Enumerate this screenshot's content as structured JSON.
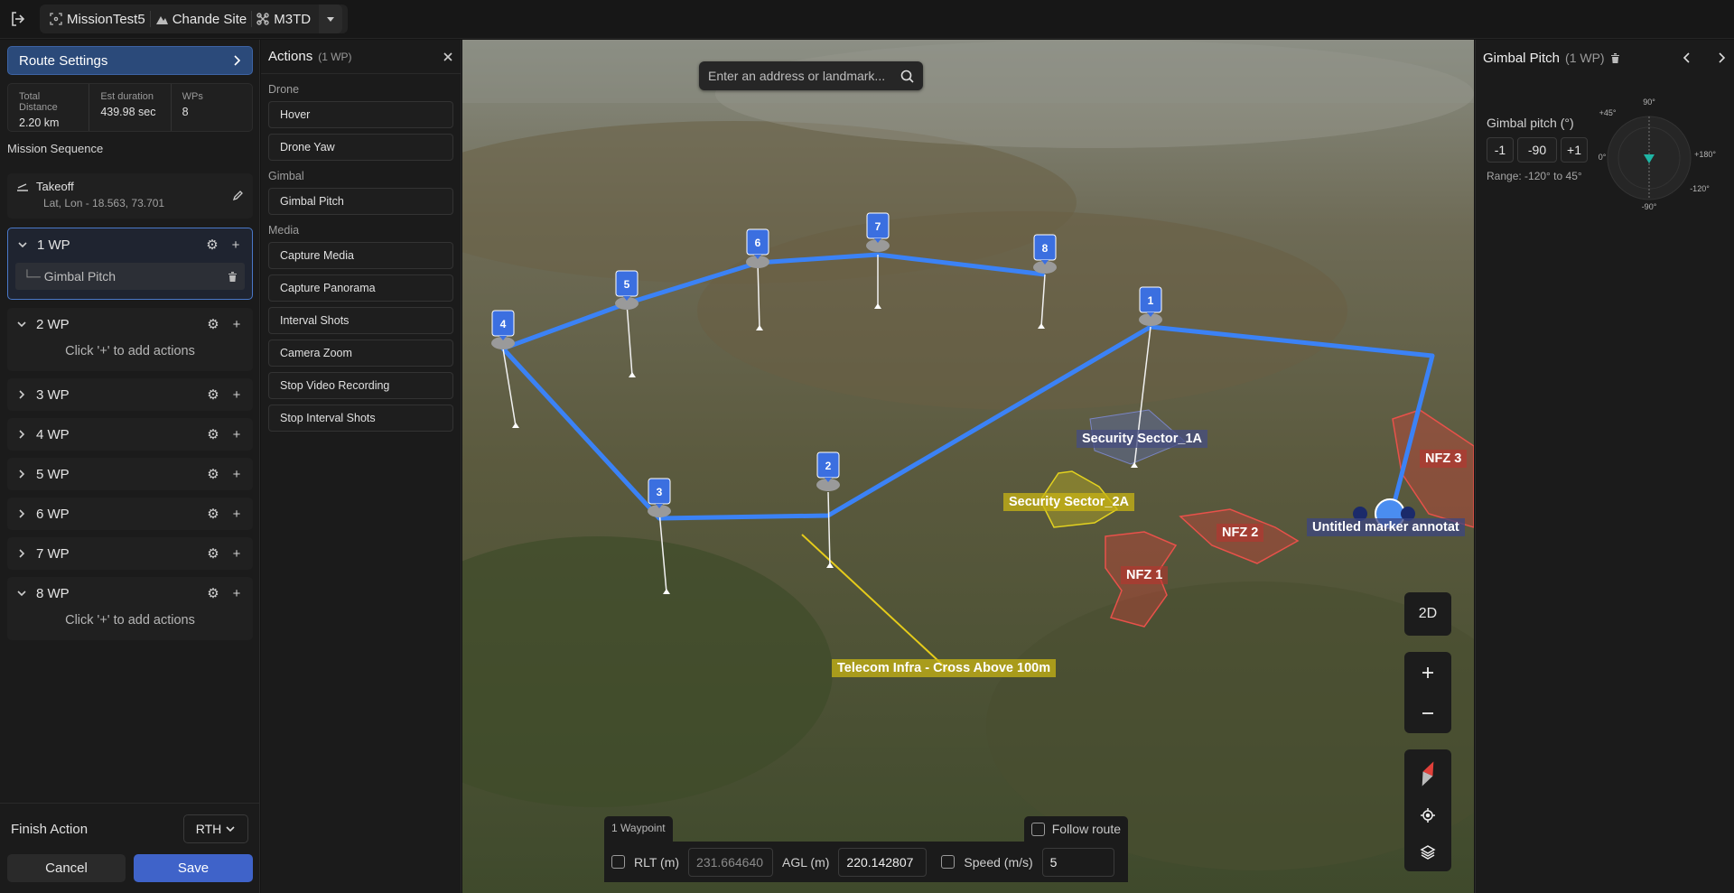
{
  "topbar": {
    "crumbs": [
      {
        "label": "MissionTest5",
        "icon": "mission-icon"
      },
      {
        "label": "Chande Site",
        "icon": "site-icon"
      },
      {
        "label": "M3TD",
        "icon": "drone-icon"
      }
    ]
  },
  "left": {
    "route_settings": "Route Settings",
    "stats": [
      {
        "label": "Total Distance",
        "value": "2.20 km"
      },
      {
        "label": "Est duration",
        "value": "439.98 sec"
      },
      {
        "label": "WPs",
        "value": "8"
      }
    ],
    "sequence_title": "Mission Sequence",
    "takeoff": {
      "title": "Takeoff",
      "coords": "Lat, Lon - 18.563, 73.701"
    },
    "waypoints": [
      {
        "name": "1 WP",
        "expanded": true,
        "action": "Gimbal Pitch"
      },
      {
        "name": "2 WP",
        "expanded": true,
        "hint": "Click '+' to add actions"
      },
      {
        "name": "3 WP"
      },
      {
        "name": "4 WP"
      },
      {
        "name": "5 WP"
      },
      {
        "name": "6 WP"
      },
      {
        "name": "7 WP"
      },
      {
        "name": "8 WP",
        "expanded": true,
        "hint": "Click '+' to add actions"
      }
    ],
    "finish_action_label": "Finish Action",
    "finish_action_value": "RTH",
    "cancel": "Cancel",
    "save": "Save"
  },
  "actions": {
    "title": "Actions",
    "count": "(1 WP)",
    "groups": [
      {
        "name": "Drone",
        "items": [
          "Hover",
          "Drone Yaw"
        ]
      },
      {
        "name": "Gimbal",
        "items": [
          "Gimbal Pitch"
        ]
      },
      {
        "name": "Media",
        "items": [
          "Capture Media",
          "Capture Panorama",
          "Interval Shots",
          "Camera Zoom",
          "Stop Video Recording",
          "Stop Interval Shots"
        ]
      }
    ]
  },
  "map": {
    "search_placeholder": "Enter an address or landmark...",
    "waypoint_markers": [
      "1",
      "2",
      "3",
      "4",
      "5",
      "6",
      "7",
      "8"
    ],
    "labels": {
      "sec1a": "Security Sector_1A",
      "sec2a": "Security Sector_2A",
      "nfz1": "NFZ 1",
      "nfz2": "NFZ 2",
      "nfz3": "NFZ 3",
      "untitled": "Untitled marker annotat",
      "telecom": "Telecom Infra - Cross Above 100m"
    },
    "mode_toggle": "2D",
    "bottom": {
      "tab": "1 Waypoint",
      "follow": "Follow route",
      "rlt_label": "RLT (m)",
      "rlt_value": "231.664640",
      "agl_label": "AGL (m)",
      "agl_value": "220.142807",
      "speed_label": "Speed (m/s)",
      "speed_value": "5"
    },
    "colors": {
      "route": "#3b82f6",
      "nfz": "#e0403a",
      "sector_yellow": "#d4c21c",
      "sector_blue": "#5b6aa8"
    }
  },
  "right": {
    "title": "Gimbal Pitch",
    "count": "(1 WP)",
    "pitch_label": "Gimbal pitch (°)",
    "minus": "-1",
    "value": "-90",
    "plus": "+1",
    "range": "Range: -120° to 45°",
    "dial_labels": {
      "top": "90°",
      "p45": "+45°",
      "zero": "0°",
      "p180": "+180°",
      "m120": "-120°",
      "m90": "-90°"
    }
  }
}
